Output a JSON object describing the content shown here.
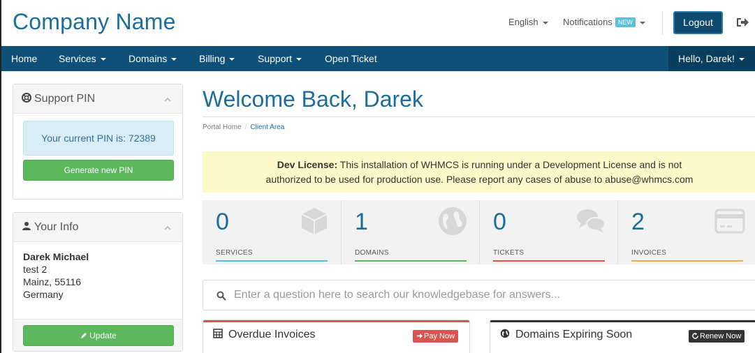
{
  "header": {
    "company_name": "Company Name",
    "language": "English",
    "notifications": "Notifications",
    "new_badge": "NEW",
    "logout": "Logout"
  },
  "nav": {
    "items": [
      "Home",
      "Services",
      "Domains",
      "Billing",
      "Support",
      "Open Ticket"
    ],
    "greeting": "Hello, Darek!"
  },
  "sidebar": {
    "support_pin": {
      "title": "Support PIN",
      "pin_text": "Your current PIN is: 72389",
      "button": "Generate new PIN"
    },
    "your_info": {
      "title": "Your Info",
      "name": "Darek Michael",
      "line1": "test 2",
      "line2": "Mainz, 55116",
      "line3": "Germany",
      "button": "Update"
    }
  },
  "main": {
    "welcome": "Welcome Back, Darek",
    "breadcrumb": {
      "home": "Portal Home",
      "separator": "/",
      "current": "Client Area"
    },
    "dev_license": {
      "label": "Dev License:",
      "line1": "This installation of WHMCS is running under a Development License and is not",
      "line2": "authorized to be used for production use. Please report any cases of abuse to abuse@whmcs.com"
    },
    "stats": [
      {
        "value": "0",
        "label": "SERVICES",
        "color": "#5bc0de",
        "icon": "cube-icon"
      },
      {
        "value": "1",
        "label": "DOMAINS",
        "color": "#5cb85c",
        "icon": "globe-icon"
      },
      {
        "value": "0",
        "label": "TICKETS",
        "color": "#d9534f",
        "icon": "comments-icon"
      },
      {
        "value": "2",
        "label": "INVOICES",
        "color": "#f0ad4e",
        "icon": "credit-card-icon"
      }
    ],
    "search": {
      "placeholder": "Enter a question here to search our knowledgebase for answers..."
    },
    "overdue": {
      "title": "Overdue Invoices",
      "button": "Pay Now",
      "color": "#d9534f"
    },
    "domains_expiring": {
      "title": "Domains Expiring Soon",
      "button": "Renew Now",
      "color": "#333333"
    }
  }
}
